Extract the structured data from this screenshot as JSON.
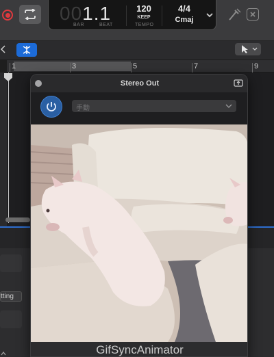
{
  "transport": {
    "position_dim": "00",
    "position_bright": "1.1",
    "bar_label": "BAR",
    "beat_label": "BEAT",
    "tempo_value": "120",
    "tempo_mode": "KEEP",
    "tempo_label": "TEMPO",
    "time_signature": "4/4",
    "key": "Cmaj"
  },
  "ruler": {
    "markers": [
      "1",
      "3",
      "5",
      "7",
      "9"
    ]
  },
  "bottom_panel": {
    "setting_chip": "tting"
  },
  "plugin_window": {
    "title": "Stereo Out",
    "preset_placeholder": "手動",
    "caption": "GifSyncAnimator"
  },
  "colors": {
    "accent_blue": "#1c6bd8",
    "record_red": "#e0393e",
    "power_blue": "#2a5fa3"
  },
  "icons": [
    "record-icon",
    "cycle-icon",
    "chevron-down-icon",
    "tuner-icon",
    "close-icon",
    "marquee-cursor-icon",
    "pointer-icon",
    "power-icon",
    "link-icon"
  ]
}
